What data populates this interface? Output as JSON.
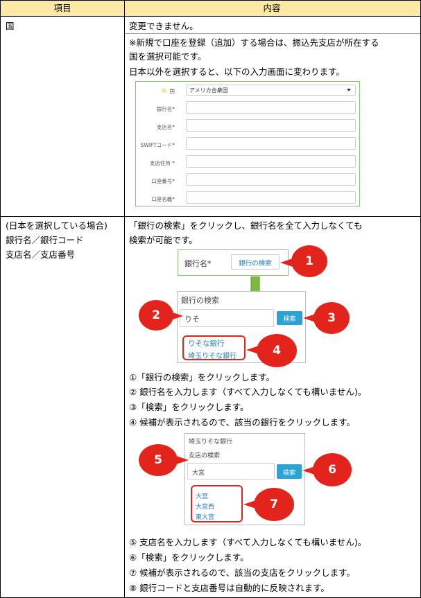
{
  "header": {
    "col1": "項目",
    "col2": "内容"
  },
  "row1": {
    "item": "国",
    "lines": [
      "変更できません。",
      "※新規で口座を登録（追加）する場合は、振込先支店が所在する",
      "国を選択可能です。",
      "日本以外を選択すると、以下の入力画面に変わります。"
    ],
    "form": {
      "country_label": "国",
      "country_value": "アメリカ合衆国",
      "fields": [
        "銀行名*",
        "支店名*",
        "SWIFTコード*",
        "支店住所 *",
        "口座番号*",
        "口座名義*"
      ]
    }
  },
  "row2": {
    "item_lines": [
      "(日本を選択している場合)",
      "銀行名／銀行コード",
      "支店名／支店番号"
    ],
    "intro": [
      "「銀行の検索」をクリックし、銀行名を全て入力しなくても",
      "検索が可能です。"
    ],
    "bank_label": "銀行名*",
    "bank_search_button": "銀行の検索",
    "bank_panel_title": "銀行の検索",
    "bank_input_value": "りそ",
    "search_button": "検索",
    "bank_results": [
      "りそな銀行",
      "埼玉りそな銀行"
    ],
    "steps_a": [
      "①「銀行の検索」をクリックします。",
      "② 銀行名を入力します（すべて入力しなくても構いません)。",
      "③「検索」をクリックします。",
      "④ 候補が表示されるので、該当の銀行をクリックします。"
    ],
    "branch_bank_name": "埼玉りそな銀行",
    "branch_panel_title": "支店の検索",
    "branch_input_value": "大宮",
    "branch_results": [
      "大宮",
      "大宮西",
      "東大宮"
    ],
    "steps_b": [
      "⑤ 支店名を入力します（すべて入力しなくても構いません)。",
      "⑥「検索」をクリックします。",
      "⑦ 候補が表示されるので、該当の支店をクリックします。",
      "⑧ 銀行コードと支店番号は自動的に反映されます。"
    ],
    "callouts": [
      "1",
      "2",
      "3",
      "4",
      "5",
      "6",
      "7"
    ]
  },
  "colors": {
    "header_bg": "#fde9a6",
    "callout": "#e3241c",
    "button": "#2aa4d7",
    "link": "#1f7ec2",
    "arrow": "#7dbb3c"
  }
}
